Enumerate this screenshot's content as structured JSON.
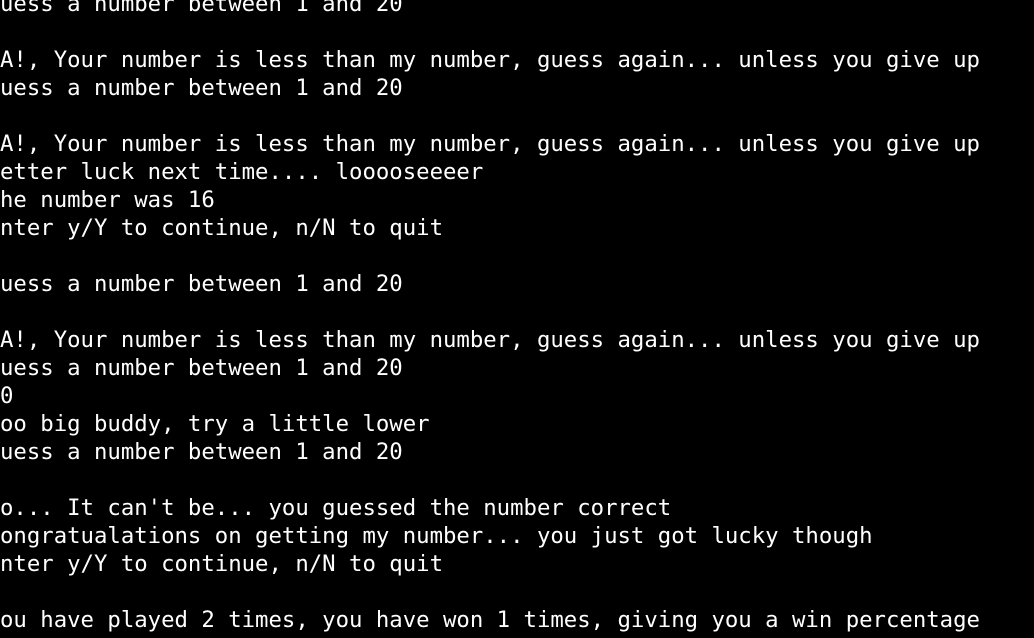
{
  "terminal": {
    "colors": {
      "background": "#000000",
      "text": "#ffffff"
    },
    "lines": [
      "uess a number between 1 and 20",
      "",
      "A!, Your number is less than my number, guess again... unless you give up",
      "uess a number between 1 and 20",
      "",
      "A!, Your number is less than my number, guess again... unless you give up",
      "etter luck next time.... looooseeeer",
      "he number was 16",
      "nter y/Y to continue, n/N to quit",
      "",
      "uess a number between 1 and 20",
      "",
      "A!, Your number is less than my number, guess again... unless you give up",
      "uess a number between 1 and 20",
      "0",
      "oo big buddy, try a little lower",
      "uess a number between 1 and 20",
      "",
      "o... It can't be... you guessed the number correct",
      "ongratualations on getting my number... you just got lucky though",
      "nter y/Y to continue, n/N to quit",
      "",
      "ou have played 2 times, you have won 1 times, giving you a win percentage"
    ]
  }
}
